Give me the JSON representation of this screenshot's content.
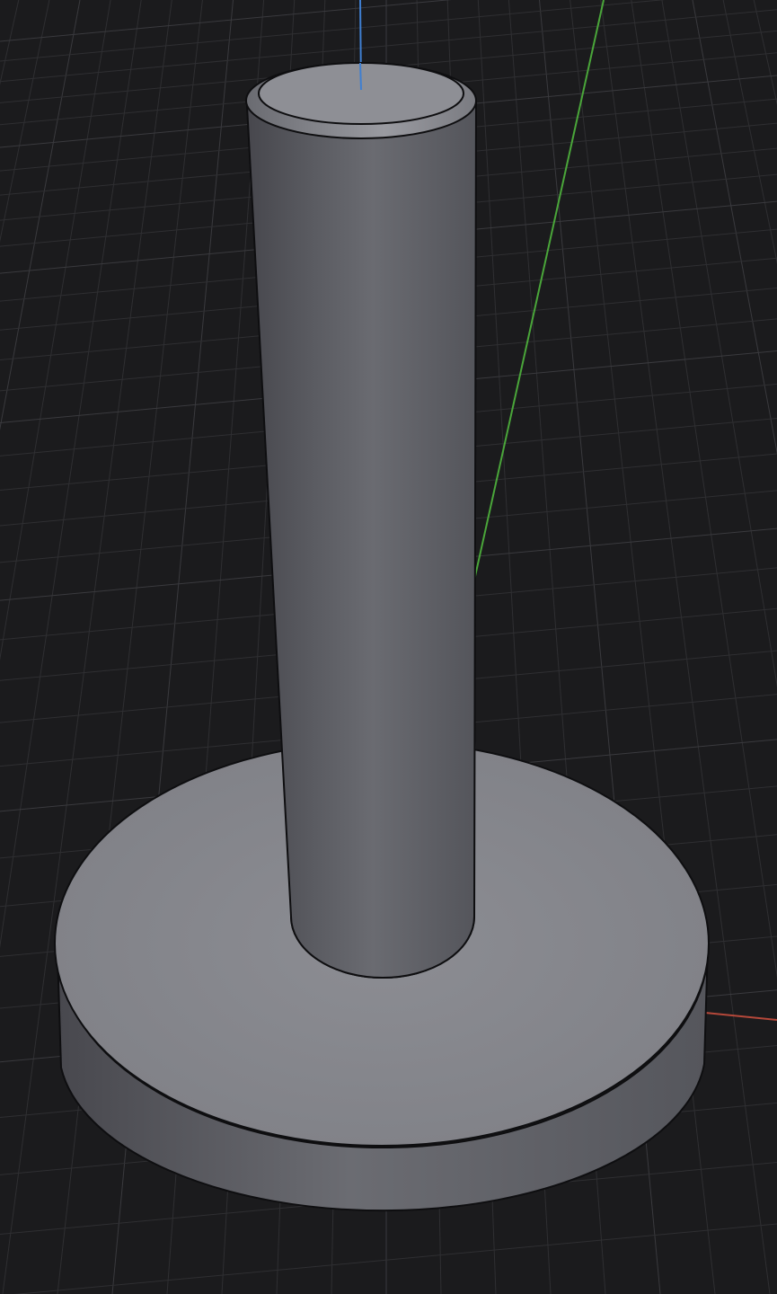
{
  "viewport": {
    "background": "#1b1b1d",
    "grid_color": "#2f2f32",
    "grid_major_color": "#3a3a3e"
  },
  "axes": {
    "x": {
      "color": "#b5483a"
    },
    "y": {
      "color": "#4aa63a"
    },
    "z": {
      "color": "#3f7fd1"
    }
  },
  "object": {
    "shape": "cylinder-on-disc",
    "shading": "solid",
    "outline_color": "#0e0e10",
    "top_face_color": "#8f9096",
    "body_colors": [
      "#4a4a50",
      "#5d5e64",
      "#6b6c72",
      "#575860"
    ],
    "base_top_color": "#85868c",
    "base_side_colors": [
      "#4c4c52",
      "#6a6b71",
      "#5a5b61"
    ]
  }
}
